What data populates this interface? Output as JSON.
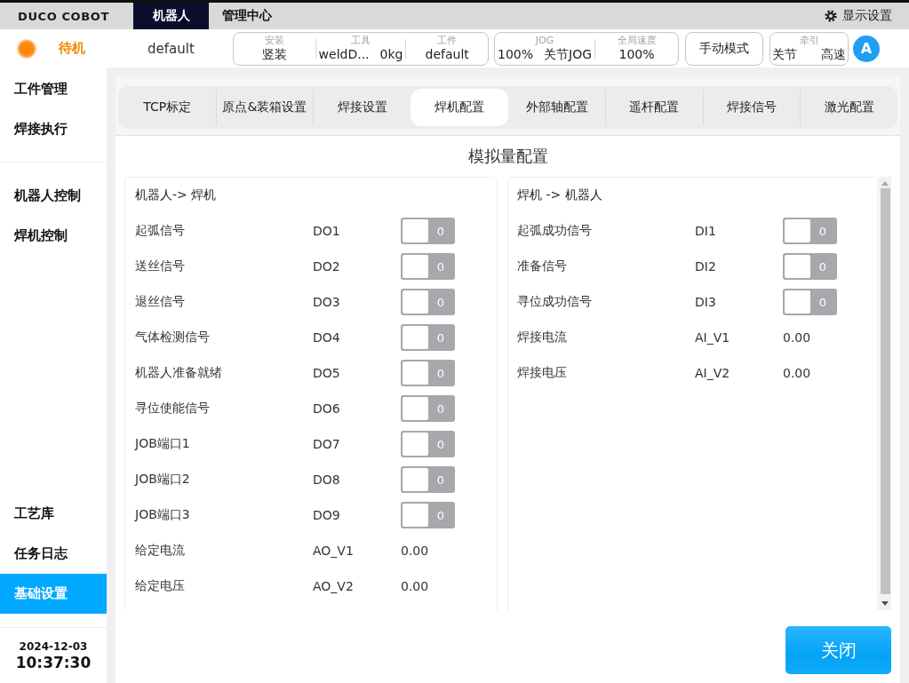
{
  "top_bar": {
    "logo": "DUCO COBOT",
    "tabs": [
      {
        "label": "机器人",
        "selected": true
      },
      {
        "label": "管理中心",
        "selected": false
      }
    ],
    "display_settings": "显示设置"
  },
  "status_bar": {
    "state": "待机",
    "program": "default",
    "groups": [
      {
        "fields": [
          {
            "label": "安装",
            "value": "竖装"
          },
          {
            "label": "工具",
            "value": "weldD...",
            "extra": "0kg"
          },
          {
            "label": "工件",
            "value": "default"
          }
        ]
      },
      {
        "fields": [
          {
            "label": "JOG",
            "value": "100%",
            "extra": "关节JOG"
          },
          {
            "label": "全局速度",
            "value": "100%"
          }
        ]
      }
    ],
    "mode_button": "手动模式",
    "traction": {
      "label": "牵引",
      "mode": "关节",
      "speed": "高速"
    },
    "avatar": "A"
  },
  "sidebar": {
    "sections": [
      {
        "items": [
          {
            "label": "工件管理",
            "selected": false
          },
          {
            "label": "焊接执行",
            "selected": false
          }
        ]
      },
      {
        "items": [
          {
            "label": "机器人控制",
            "selected": false
          },
          {
            "label": "焊机控制",
            "selected": false
          }
        ]
      },
      {
        "items": [
          {
            "label": "工艺库",
            "selected": false
          },
          {
            "label": "任务日志",
            "selected": false
          },
          {
            "label": "基础设置",
            "selected": true
          }
        ]
      }
    ],
    "date": "2024-12-03",
    "time": "10:37:30"
  },
  "config_tabs": [
    {
      "label": "TCP标定",
      "selected": false
    },
    {
      "label": "原点&装箱设置",
      "selected": false
    },
    {
      "label": "焊接设置",
      "selected": false
    },
    {
      "label": "焊机配置",
      "selected": true
    },
    {
      "label": "外部轴配置",
      "selected": false
    },
    {
      "label": "遥杆配置",
      "selected": false
    },
    {
      "label": "焊接信号",
      "selected": false
    },
    {
      "label": "激光配置",
      "selected": false
    }
  ],
  "panel_title": "模拟量配置",
  "cards": [
    {
      "title": "机器人-> 焊机",
      "rows": [
        {
          "kind": "switch",
          "name": "起弧信号",
          "port": "DO1",
          "on": false,
          "value": "0"
        },
        {
          "kind": "switch",
          "name": "送丝信号",
          "port": "DO2",
          "on": false,
          "value": "0"
        },
        {
          "kind": "switch",
          "name": "退丝信号",
          "port": "DO3",
          "on": false,
          "value": "0"
        },
        {
          "kind": "switch",
          "name": "气体检测信号",
          "port": "DO4",
          "on": false,
          "value": "0"
        },
        {
          "kind": "switch",
          "name": "机器人准备就绪",
          "port": "DO5",
          "on": false,
          "value": "0"
        },
        {
          "kind": "switch",
          "name": "寻位使能信号",
          "port": "DO6",
          "on": false,
          "value": "0"
        },
        {
          "kind": "switch",
          "name": "JOB端口1",
          "port": "DO7",
          "on": false,
          "value": "0"
        },
        {
          "kind": "switch",
          "name": "JOB端口2",
          "port": "DO8",
          "on": false,
          "value": "0"
        },
        {
          "kind": "switch",
          "name": "JOB端口3",
          "port": "DO9",
          "on": false,
          "value": "0"
        },
        {
          "kind": "value",
          "name": "给定电流",
          "port": "AO_V1",
          "value": "0.00"
        },
        {
          "kind": "value",
          "name": "给定电压",
          "port": "AO_V2",
          "value": "0.00"
        }
      ]
    },
    {
      "title": "焊机 -> 机器人",
      "rows": [
        {
          "kind": "switch",
          "name": "起弧成功信号",
          "port": "DI1",
          "on": false,
          "value": "0"
        },
        {
          "kind": "switch",
          "name": "准备信号",
          "port": "DI2",
          "on": false,
          "value": "0"
        },
        {
          "kind": "switch",
          "name": "寻位成功信号",
          "port": "DI3",
          "on": false,
          "value": "0"
        },
        {
          "kind": "value",
          "name": "焊接电流",
          "port": "AI_V1",
          "value": "0.00"
        },
        {
          "kind": "value",
          "name": "焊接电压",
          "port": "AI_V2",
          "value": "0.00"
        }
      ]
    }
  ],
  "close_button": "关闭"
}
